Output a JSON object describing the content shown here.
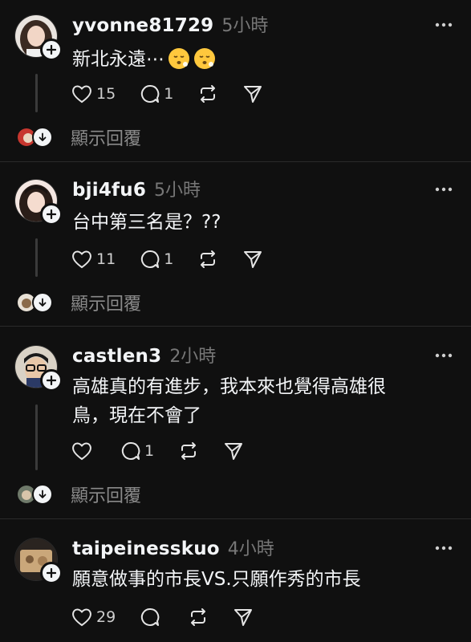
{
  "posts": [
    {
      "username": "yvonne81729",
      "time": "5小時",
      "text": "新北永遠⋯",
      "emoji": [
        "face-exhaling-emoji",
        "face-exhaling-emoji"
      ],
      "likes": "15",
      "replies": "1",
      "show_replies": "顯示回覆"
    },
    {
      "username": "bji4fu6",
      "time": "5小時",
      "text": "台中第三名是？??",
      "likes": "11",
      "replies": "1",
      "show_replies": "顯示回覆"
    },
    {
      "username": "castlen3",
      "time": "2小時",
      "text_line1": "高雄真的有進步，我本來也覺得高雄很",
      "text_line2": "鳥，現在不會了",
      "likes": "",
      "replies": "1",
      "show_replies": "顯示回覆"
    },
    {
      "username": "taipeinesskuo",
      "time": "4小時",
      "text": "願意做事的市長VS.只願作秀的市長",
      "likes": "29",
      "replies": ""
    }
  ],
  "colors": {
    "background": "#101010",
    "text": "#f3f5f7",
    "muted": "#777777",
    "divider": "#2a2a2a"
  }
}
